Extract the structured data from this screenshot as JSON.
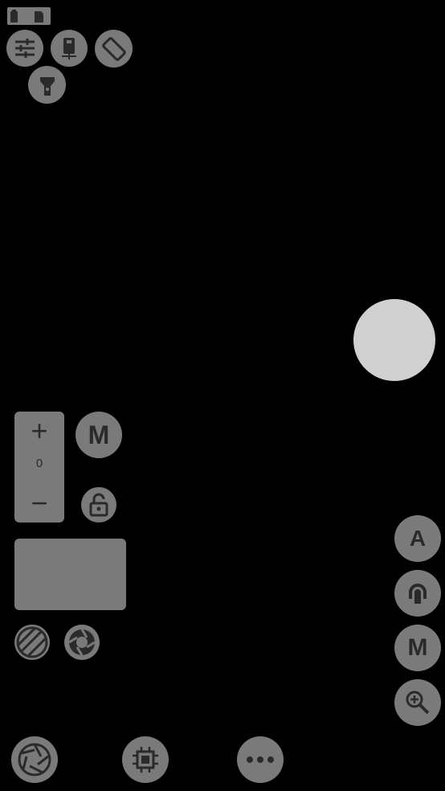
{
  "status_indicator": {
    "icons": [
      "battery-icon",
      "sd-card-icon"
    ]
  },
  "top_controls": {
    "icons": [
      "settings-sliders-icon",
      "phone-orientation-icon",
      "auto-rotate-icon",
      "flashlight-icon"
    ]
  },
  "shutter": {
    "icon": "shutter-circle-icon",
    "color": "#d0d0d0"
  },
  "exposure_panel": {
    "plus": "+",
    "value": "0",
    "minus": "−"
  },
  "mode_button": {
    "label": "M"
  },
  "lock_button": {
    "icon": "unlock-icon"
  },
  "preview_panel": {
    "color": "#7a7a7a"
  },
  "filter_buttons": {
    "icons": [
      "stripes-filter-icon",
      "aperture-icon"
    ]
  },
  "right_controls": {
    "auto_label": "A",
    "icon_2": "hearing-icon",
    "manual_label": "M",
    "icon_4": "zoom-in-icon"
  },
  "bottom_bar": {
    "icons": [
      "shutter-aperture-icon",
      "processor-chip-icon",
      "more-options-icon"
    ]
  },
  "colors": {
    "background": "#000000",
    "button": "#7a7a7a",
    "icon_dark": "#2a2a2a",
    "shutter": "#d0d0d0"
  }
}
